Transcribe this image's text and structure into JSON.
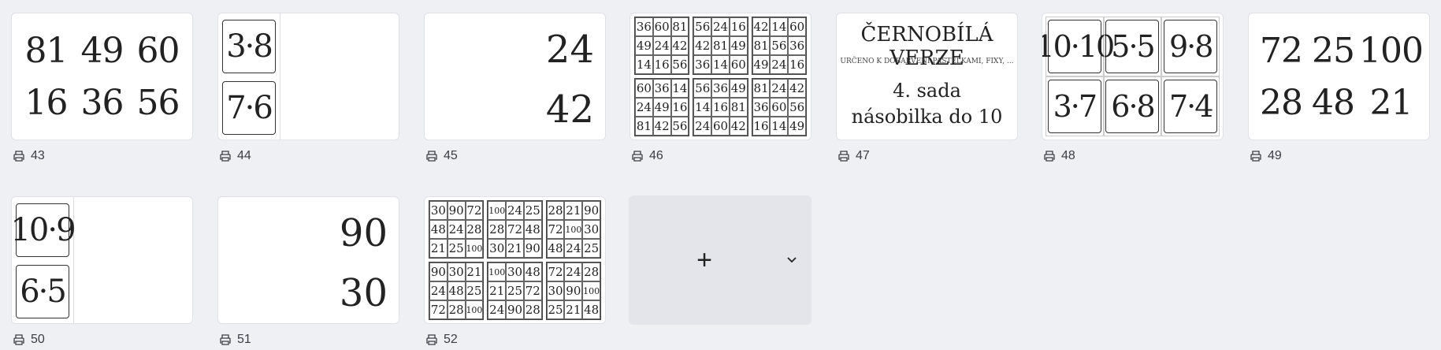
{
  "pages": [
    {
      "number": "43",
      "type": "grid6",
      "values": [
        "81",
        "49",
        "60",
        "16",
        "36",
        "56"
      ]
    },
    {
      "number": "44",
      "type": "boxcol",
      "values": [
        "3·8",
        "7·6"
      ]
    },
    {
      "number": "45",
      "type": "rnum",
      "values": [
        "24",
        "42"
      ]
    },
    {
      "number": "46",
      "type": "mini",
      "tables": [
        [
          "36",
          "60",
          "81",
          "49",
          "24",
          "42",
          "14",
          "16",
          "56"
        ],
        [
          "56",
          "24",
          "16",
          "42",
          "81",
          "49",
          "36",
          "14",
          "60"
        ],
        [
          "42",
          "14",
          "60",
          "81",
          "56",
          "36",
          "49",
          "24",
          "16"
        ],
        [
          "60",
          "36",
          "14",
          "24",
          "49",
          "16",
          "81",
          "42",
          "56"
        ],
        [
          "56",
          "36",
          "49",
          "14",
          "16",
          "81",
          "24",
          "60",
          "42"
        ],
        [
          "81",
          "24",
          "42",
          "36",
          "60",
          "56",
          "16",
          "14",
          "49"
        ]
      ]
    },
    {
      "number": "47",
      "type": "title",
      "title": "ČERNOBÍLÁ VERZE",
      "subtitle": "URČENO K DOBARVENÍ PASTELKAMI, FIXY, ...",
      "line1": "4. sada",
      "line2": "násobilka do 10"
    },
    {
      "number": "48",
      "type": "boxgrid",
      "values": [
        "10·10",
        "5·5",
        "9·8",
        "3·7",
        "6·8",
        "7·4"
      ]
    },
    {
      "number": "49",
      "type": "grid6",
      "values": [
        "72",
        "25",
        "100",
        "28",
        "48",
        "21"
      ]
    },
    {
      "number": "50",
      "type": "boxcol",
      "values": [
        "10·9",
        "6·5"
      ]
    },
    {
      "number": "51",
      "type": "rnum",
      "values": [
        "90",
        "30"
      ]
    },
    {
      "number": "52",
      "type": "mini",
      "tables": [
        [
          "30",
          "90",
          "72",
          "48",
          "24",
          "28",
          "21",
          "25",
          "100"
        ],
        [
          "100",
          "24",
          "25",
          "28",
          "72",
          "48",
          "30",
          "21",
          "90"
        ],
        [
          "28",
          "21",
          "90",
          "72",
          "100",
          "30",
          "48",
          "24",
          "25"
        ],
        [
          "90",
          "30",
          "21",
          "24",
          "48",
          "25",
          "72",
          "28",
          "100"
        ],
        [
          "100",
          "30",
          "48",
          "21",
          "25",
          "72",
          "24",
          "90",
          "28"
        ],
        [
          "72",
          "24",
          "28",
          "30",
          "90",
          "100",
          "25",
          "21",
          "48"
        ]
      ]
    }
  ],
  "add": {
    "plus": "+",
    "icon": "chevron-down-icon"
  }
}
